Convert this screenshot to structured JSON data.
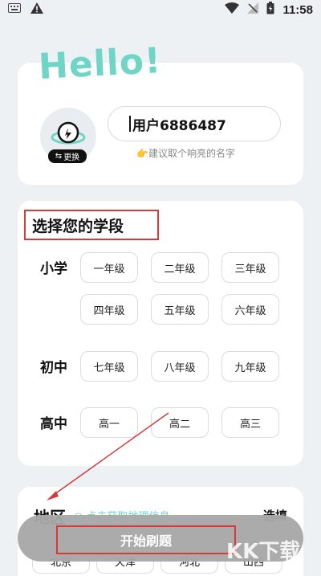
{
  "status_bar": {
    "time": "11:58"
  },
  "hello": "Hello!",
  "user": {
    "avatar_change_label": "更换",
    "username": "用户6886487",
    "hint": "👉建议取个响亮的名字"
  },
  "grade_section": {
    "title": "选择您的学段",
    "rows": [
      {
        "label": "小学",
        "items": [
          "一年级",
          "二年级",
          "三年级",
          "四年级",
          "五年级",
          "六年级"
        ]
      },
      {
        "label": "初中",
        "items": [
          "七年级",
          "八年级",
          "九年级"
        ]
      },
      {
        "label": "高中",
        "items": [
          "高一",
          "高二",
          "高三"
        ]
      }
    ]
  },
  "region_section": {
    "title": "地区",
    "locate_label": "点击获取地理信息",
    "select_label": "选填",
    "items": [
      "北京",
      "天津",
      "河北",
      "山西"
    ]
  },
  "start_button": "开始刷题",
  "watermark": {
    "text": "KK下载",
    "url": "www.kkx.net"
  },
  "colors": {
    "accent": "#6fd6c7",
    "highlight_red": "#d43b3b"
  }
}
